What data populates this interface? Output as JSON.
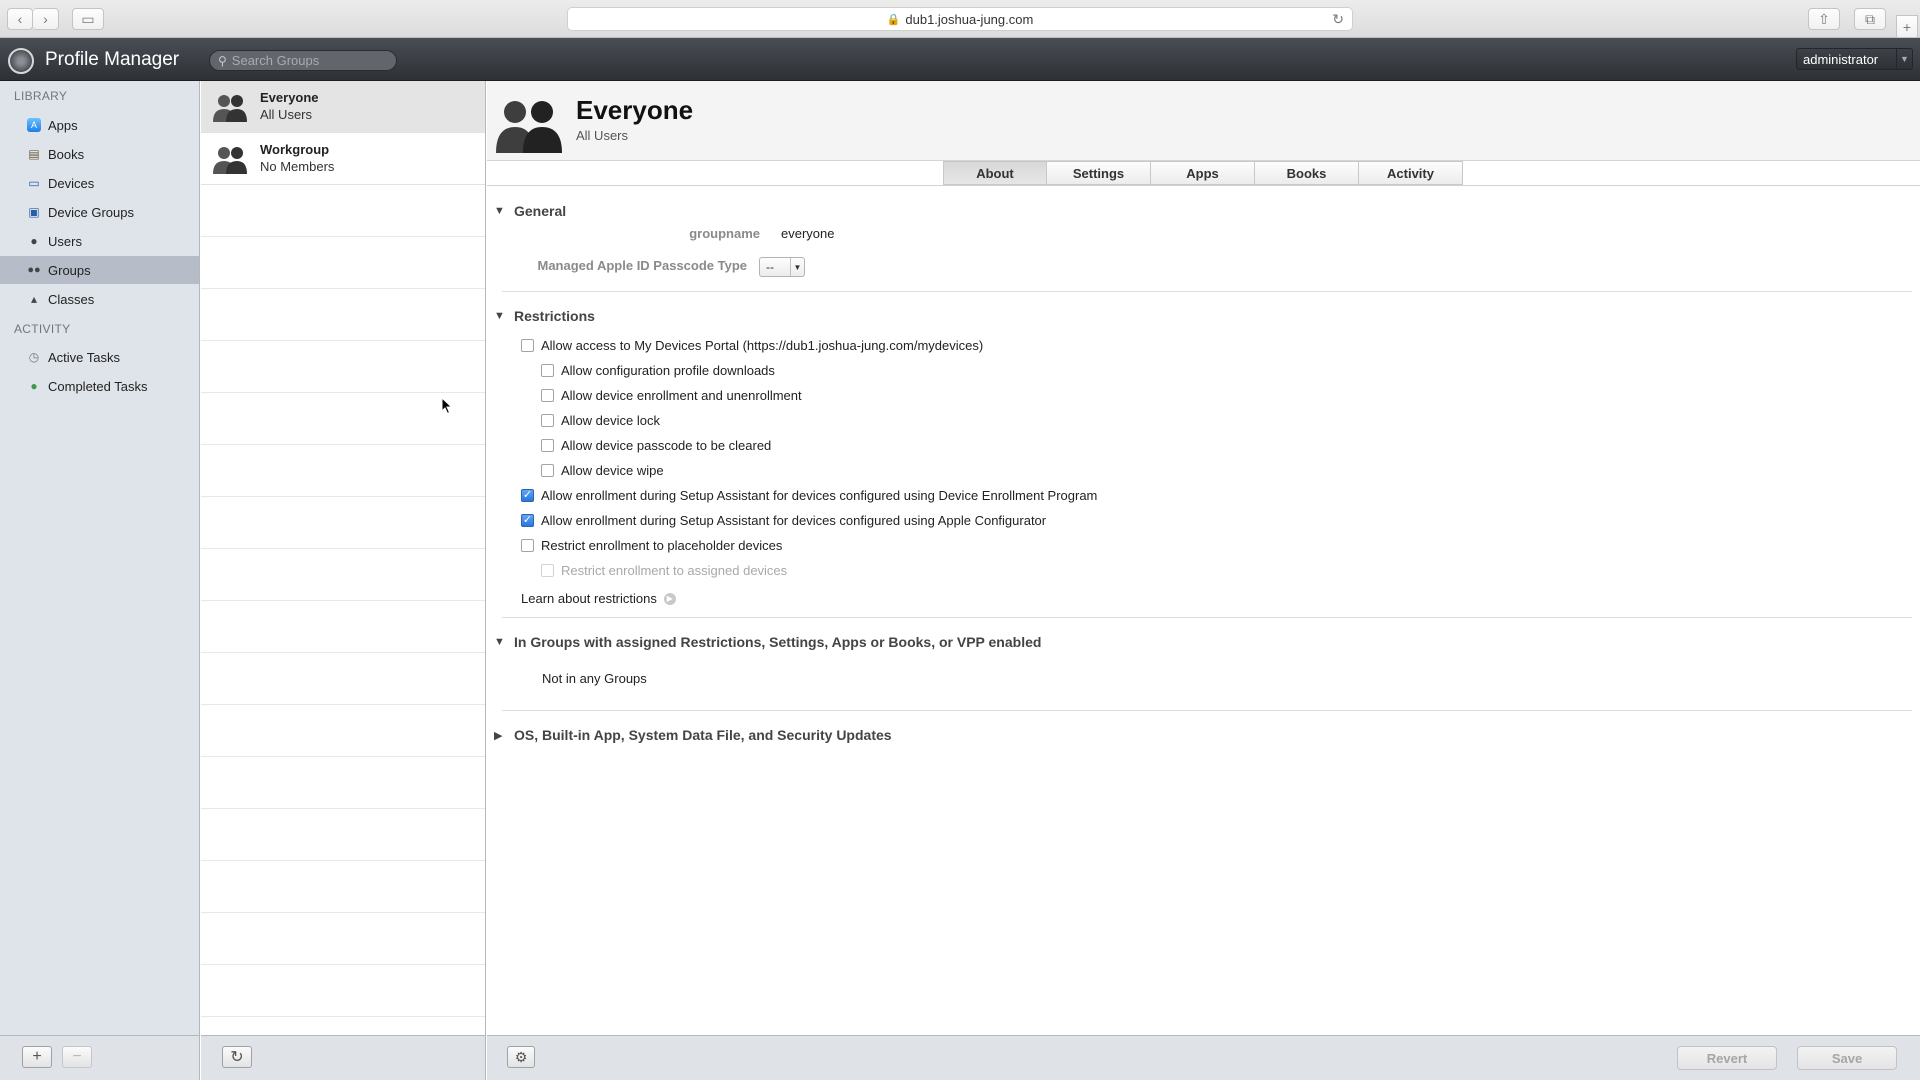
{
  "browser": {
    "url": "dub1.joshua-jung.com",
    "back_glyph": "‹",
    "forward_glyph": "›",
    "sidebar_glyph": "▭",
    "share_glyph": "⇧",
    "tabs_glyph": "⧉",
    "newtab_glyph": "+"
  },
  "app": {
    "title": "Profile Manager",
    "search_placeholder": "Search Groups",
    "user_menu": "administrator"
  },
  "sidebar": {
    "library_heading": "LIBRARY",
    "activity_heading": "ACTIVITY",
    "library_items": [
      {
        "label": "Apps",
        "icon": "apps-icon"
      },
      {
        "label": "Books",
        "icon": "books-icon"
      },
      {
        "label": "Devices",
        "icon": "devices-icon"
      },
      {
        "label": "Device Groups",
        "icon": "device-groups-icon"
      },
      {
        "label": "Users",
        "icon": "user-icon"
      },
      {
        "label": "Groups",
        "icon": "groups-icon",
        "selected": true
      },
      {
        "label": "Classes",
        "icon": "classes-icon"
      }
    ],
    "activity_items": [
      {
        "label": "Active Tasks",
        "icon": "clock-icon"
      },
      {
        "label": "Completed Tasks",
        "icon": "check-circle-icon"
      }
    ],
    "add_glyph": "+",
    "remove_glyph": "−"
  },
  "groups": [
    {
      "name": "Everyone",
      "subtitle": "All Users",
      "selected": true
    },
    {
      "name": "Workgroup",
      "subtitle": "No Members"
    }
  ],
  "grouplist": {
    "refresh_glyph": "↻"
  },
  "detail": {
    "title": "Everyone",
    "subtitle": "All Users",
    "tabs": [
      "About",
      "Settings",
      "Apps",
      "Books",
      "Activity"
    ],
    "active_tab": "About",
    "general": {
      "heading": "General",
      "groupname_label": "groupname",
      "groupname_value": "everyone",
      "passcode_label": "Managed Apple ID Passcode Type",
      "passcode_value": "--"
    },
    "restrictions": {
      "heading": "Restrictions",
      "items": [
        {
          "label": "Allow access to My Devices Portal (https://dub1.joshua-jung.com/mydevices)",
          "checked": false,
          "indent": false,
          "disabled": false
        },
        {
          "label": "Allow configuration profile downloads",
          "checked": false,
          "indent": true,
          "disabled": false
        },
        {
          "label": "Allow device enrollment and unenrollment",
          "checked": false,
          "indent": true,
          "disabled": false
        },
        {
          "label": "Allow device lock",
          "checked": false,
          "indent": true,
          "disabled": false
        },
        {
          "label": "Allow device passcode to be cleared",
          "checked": false,
          "indent": true,
          "disabled": false
        },
        {
          "label": "Allow device wipe",
          "checked": false,
          "indent": true,
          "disabled": false
        },
        {
          "label": "Allow enrollment during Setup Assistant for devices configured using Device Enrollment Program",
          "checked": true,
          "indent": false,
          "disabled": false
        },
        {
          "label": "Allow enrollment during Setup Assistant for devices configured using Apple Configurator",
          "checked": true,
          "indent": false,
          "disabled": false
        },
        {
          "label": "Restrict enrollment to placeholder devices",
          "checked": false,
          "indent": false,
          "disabled": false
        },
        {
          "label": "Restrict enrollment to assigned devices",
          "checked": false,
          "indent": true,
          "disabled": true
        }
      ],
      "learn_link": "Learn about restrictions"
    },
    "in_groups": {
      "heading": "In Groups with assigned Restrictions, Settings, Apps or Books, or VPP enabled",
      "value": "Not in any Groups"
    },
    "updates": {
      "heading": "OS, Built-in App, System Data File, and Security Updates"
    },
    "buttons": {
      "revert": "Revert",
      "save": "Save",
      "gear_glyph": "⚙"
    }
  }
}
